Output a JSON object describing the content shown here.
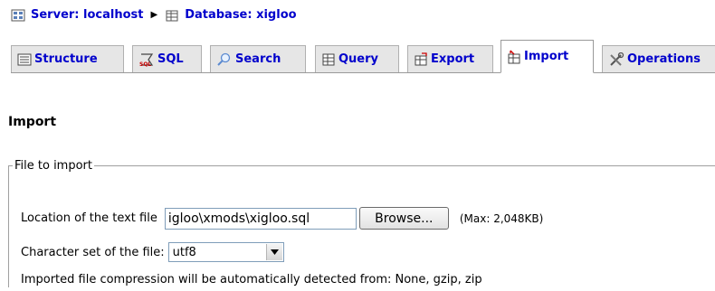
{
  "breadcrumb": {
    "server": "Server: localhost",
    "database": "Database: xigloo",
    "separator": "▶"
  },
  "tabs": [
    {
      "label": "Structure",
      "icon": "structure-icon"
    },
    {
      "label": "SQL",
      "icon": "sql-icon"
    },
    {
      "label": "Search",
      "icon": "search-icon"
    },
    {
      "label": "Query",
      "icon": "query-icon"
    },
    {
      "label": "Export",
      "icon": "export-icon"
    },
    {
      "label": "Import",
      "icon": "import-icon",
      "active": true
    },
    {
      "label": "Operations",
      "icon": "operations-icon"
    }
  ],
  "heading": "Import",
  "file_section": {
    "legend": "File to import",
    "location_label": "Location of the text file",
    "file_value": "igloo\\xmods\\xigloo.sql",
    "browse_label": "Browse...",
    "max_label": "(Max: 2,048KB)",
    "charset_label": "Character set of the file:",
    "charset_value": "utf8",
    "compression_note": "Imported file compression will be automatically detected from: None, gzip, zip"
  },
  "colors": {
    "link": "#0000cc",
    "tab_bg": "#e6e6e6",
    "border": "#9a9a9a"
  }
}
